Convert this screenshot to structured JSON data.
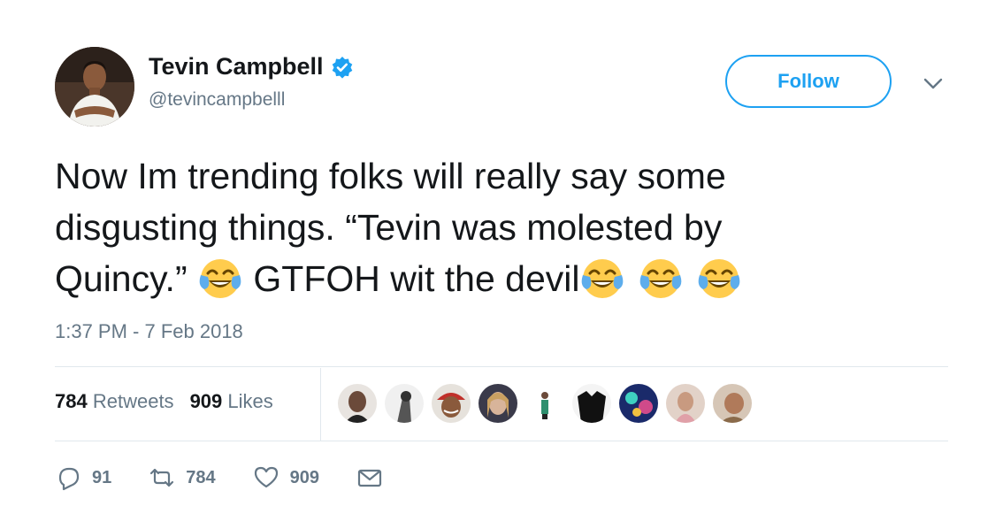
{
  "user": {
    "display_name": "Tevin Campbell",
    "handle": "@tevincampbelll",
    "verified_icon": "verified-badge-icon",
    "avatar_icon": "profile-photo"
  },
  "follow_button": {
    "label": "Follow"
  },
  "menu": {
    "icon": "chevron-down-icon"
  },
  "tweet": {
    "line1": "Now Im trending folks will really say some",
    "line2": "disgusting things. “Tevin was molested by",
    "line3a": "Quincy.” ",
    "line3b": " GTFOH wit the devil",
    "emoji": "face-with-tears-of-joy-icon"
  },
  "timestamp": "1:37 PM - 7 Feb 2018",
  "stats": {
    "retweets_count": "784",
    "retweets_label": "Retweets",
    "likes_count": "909",
    "likes_label": "Likes",
    "liker_avatars": 9
  },
  "actions": {
    "reply_count": "91",
    "retweet_count": "784",
    "like_count": "909",
    "reply_icon": "reply-icon",
    "retweet_icon": "retweet-icon",
    "like_icon": "heart-icon",
    "dm_icon": "envelope-icon"
  },
  "colors": {
    "accent": "#1da1f2",
    "text": "#14171a",
    "secondary": "#657786",
    "divider": "#e1e8ed",
    "emoji_face": "#ffcc4d",
    "emoji_tear": "#5dadec"
  }
}
